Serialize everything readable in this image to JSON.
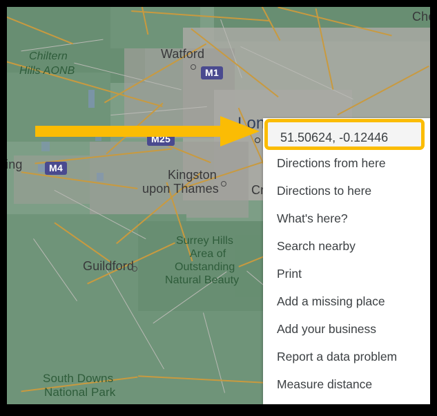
{
  "map": {
    "labels": [
      {
        "text": "Chiltern",
        "kind": "park-italic"
      },
      {
        "text": "Hills AONB",
        "kind": "park-italic"
      },
      {
        "text": "Watford",
        "kind": "city"
      },
      {
        "text": "Che",
        "kind": "city-clipped"
      },
      {
        "text": "Lon",
        "kind": "city-clipped"
      },
      {
        "text": "ding",
        "kind": "city-clipped"
      },
      {
        "text": "Kingston",
        "kind": "city"
      },
      {
        "text": "upon Thames",
        "kind": "city"
      },
      {
        "text": "Cr",
        "kind": "city-clipped"
      },
      {
        "text": "Guildford",
        "kind": "city"
      },
      {
        "text": "Surrey Hills",
        "kind": "park"
      },
      {
        "text": "Area of",
        "kind": "park"
      },
      {
        "text": "Outstanding",
        "kind": "park"
      },
      {
        "text": "Natural Beauty",
        "kind": "park"
      },
      {
        "text": "South Downs",
        "kind": "park"
      },
      {
        "text": "National Park",
        "kind": "park"
      }
    ],
    "shields": [
      {
        "text": "M1"
      },
      {
        "text": "M25"
      },
      {
        "text": "M4"
      }
    ],
    "colors": {
      "land_green": "#7d9e86",
      "urban_grey": "#a9a9a3",
      "road_orange": "#c99a3f",
      "park_label_green": "#2e5c3a",
      "shield_blue": "#4a4a8f",
      "water_blue": "#7d94b5"
    }
  },
  "annotation": {
    "arrow_color": "#fbbc04",
    "highlight_border_color": "#fbbc04",
    "highlight_fill": "#f4f4f4"
  },
  "context_menu": {
    "coordinates": "51.50624, -0.12446",
    "items": [
      "Directions from here",
      "Directions to here",
      "What's here?",
      "Search nearby",
      "Print",
      "Add a missing place",
      "Add your business",
      "Report a data problem",
      "Measure distance"
    ]
  }
}
